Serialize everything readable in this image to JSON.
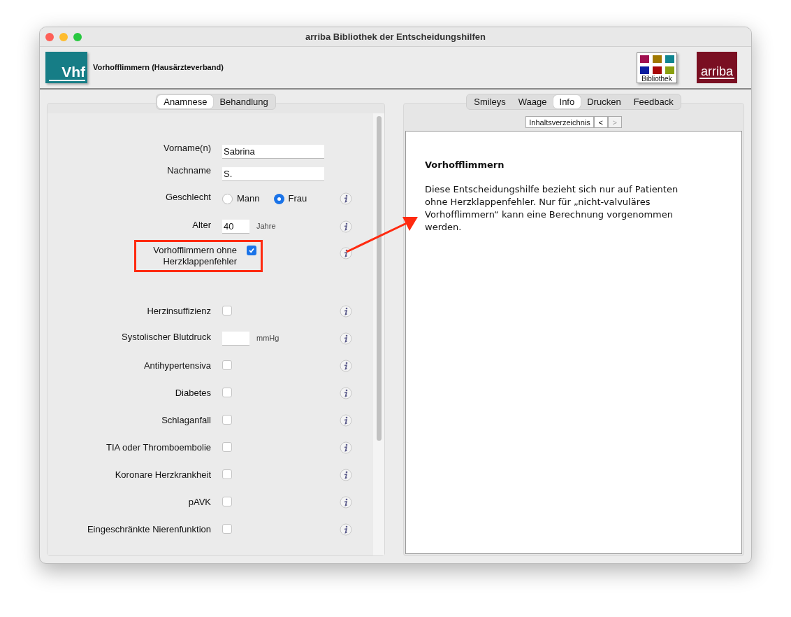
{
  "window": {
    "title": "arriba Bibliothek der Entscheidungshilfen"
  },
  "header": {
    "logo": "Vhf",
    "title": "Vorhofflimmern (Hausärzteverband)",
    "library_label": "Bibliothek",
    "brand": "arriba"
  },
  "left_tabs": [
    {
      "label": "Anamnese",
      "selected": true
    },
    {
      "label": "Behandlung",
      "selected": false
    }
  ],
  "form": [
    {
      "kind": "text",
      "label": "Vorname(n)",
      "value": "Sabrina",
      "info": false
    },
    {
      "kind": "text",
      "label": "Nachname",
      "value": "S.",
      "info": false
    },
    {
      "kind": "radio",
      "label": "Geschlecht",
      "options": [
        {
          "label": "Mann",
          "selected": false
        },
        {
          "label": "Frau",
          "selected": true
        }
      ],
      "info": true
    },
    {
      "kind": "number",
      "label": "Alter",
      "value": "40",
      "unit": "Jahre",
      "info": true
    },
    {
      "kind": "checkbox",
      "label": "Vorhofflimmern ohne Herzklappenfehler",
      "checked": true,
      "highlighted": true,
      "info": true
    },
    {
      "kind": "checkbox",
      "label": "Herzinsuffizienz",
      "checked": false,
      "highlighted": false,
      "info": true
    },
    {
      "kind": "number",
      "label": "Systolischer Blutdruck",
      "unit": "mmHg",
      "info": true
    },
    {
      "kind": "checkbox",
      "label": "Antihypertensiva",
      "checked": false,
      "highlighted": false,
      "info": true
    },
    {
      "kind": "checkbox",
      "label": "Diabetes",
      "checked": false,
      "highlighted": false,
      "info": true
    },
    {
      "kind": "checkbox",
      "label": "Schlaganfall",
      "checked": false,
      "highlighted": false,
      "info": true
    },
    {
      "kind": "checkbox",
      "label": "TIA oder Thromboembolie",
      "checked": false,
      "highlighted": false,
      "info": true
    },
    {
      "kind": "checkbox",
      "label": "Koronare Herzkrankheit",
      "checked": false,
      "highlighted": false,
      "info": true
    },
    {
      "kind": "checkbox",
      "label": "pAVK",
      "checked": false,
      "highlighted": false,
      "info": true
    },
    {
      "kind": "checkbox",
      "label": "Eingeschränkte Nierenfunktion",
      "checked": false,
      "highlighted": false,
      "info": true
    }
  ],
  "right_tabs": [
    {
      "label": "Smileys",
      "selected": false
    },
    {
      "label": "Waage",
      "selected": false
    },
    {
      "label": "Info",
      "selected": true
    },
    {
      "label": "Drucken",
      "selected": false
    },
    {
      "label": "Feedback",
      "selected": false
    }
  ],
  "nav": {
    "toc": "Inhaltsverzeichnis",
    "back": {
      "label": "<",
      "disabled": false
    },
    "forward": {
      "label": ">",
      "disabled": true
    }
  },
  "info": {
    "heading": "Vorhofflimmern",
    "text": "Diese Entscheidungshilfe bezieht sich nur auf Patienten ohne Herzklappenfehler. Nur für „nicht-valvuläres Vorhofflimmern“ kann eine Berechnung vorgenommen werden."
  }
}
